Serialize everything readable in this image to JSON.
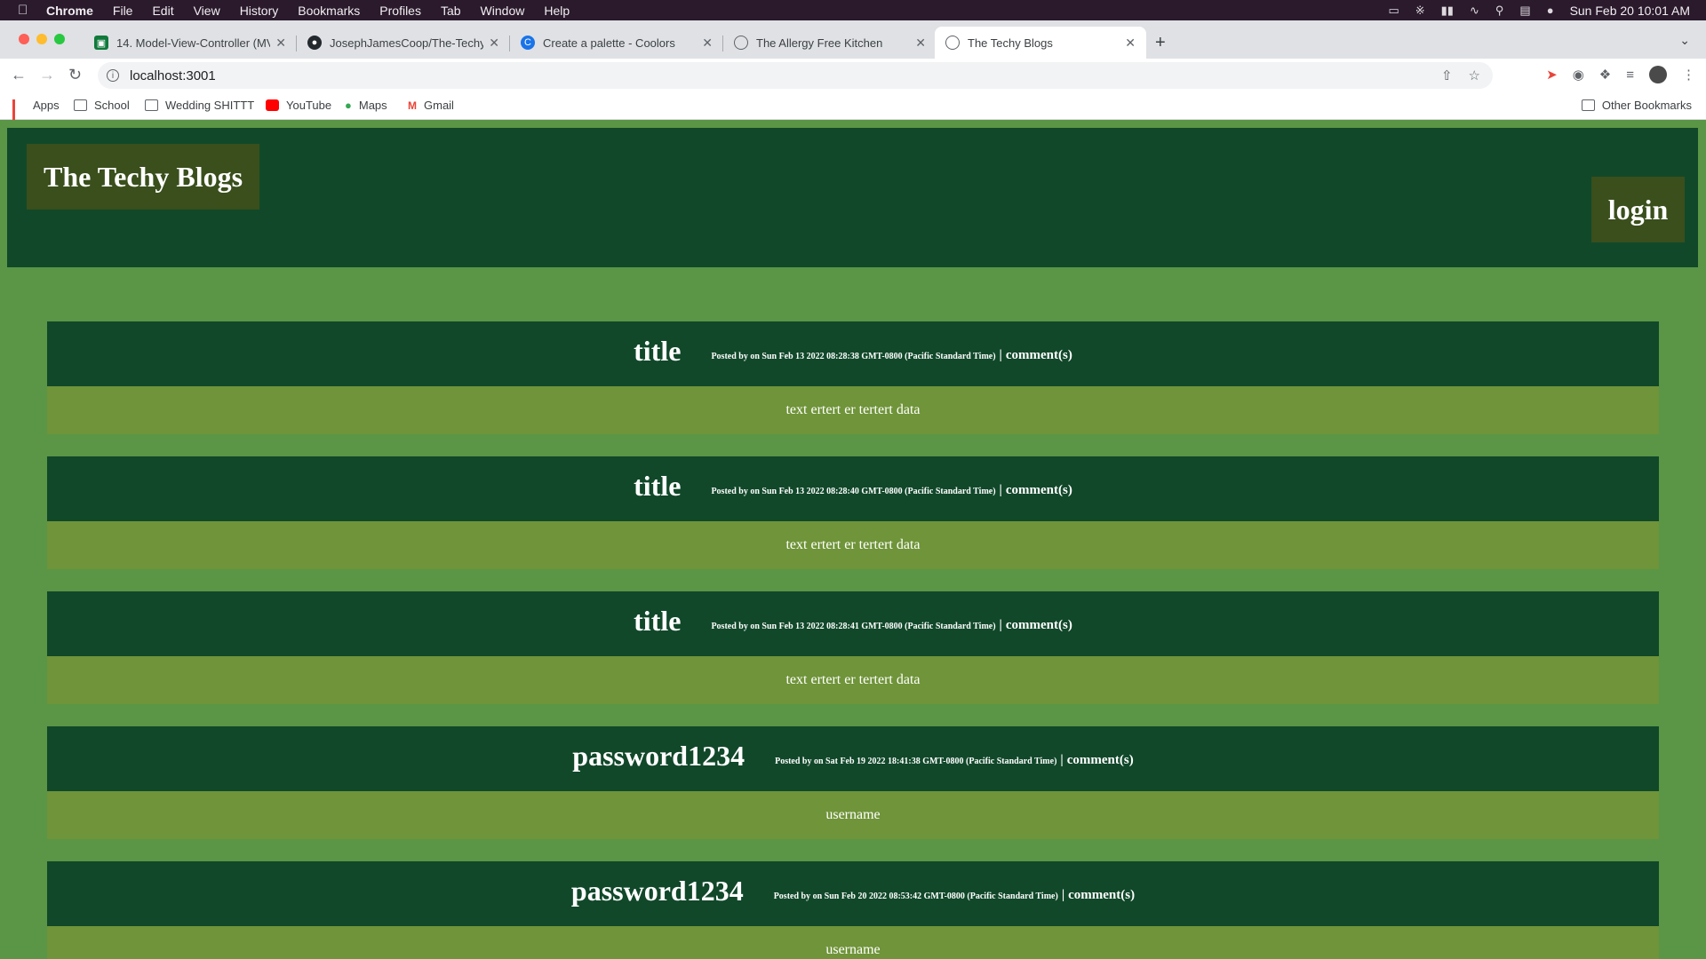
{
  "menubar": {
    "app": "Chrome",
    "items": [
      "File",
      "Edit",
      "View",
      "History",
      "Bookmarks",
      "Profiles",
      "Tab",
      "Window",
      "Help"
    ],
    "clock": "Sun Feb 20  10:01 AM"
  },
  "tabs": [
    {
      "label": "14. Model-View-Controller (MV",
      "favicon": "green-square-icon"
    },
    {
      "label": "JosephJamesCoop/The-Techy",
      "favicon": "github-icon"
    },
    {
      "label": "Create a palette - Coolors",
      "favicon": "coolors-icon"
    },
    {
      "label": "The Allergy Free Kitchen",
      "favicon": "globe-icon"
    },
    {
      "label": "The Techy Blogs",
      "favicon": "globe-icon",
      "active": true
    }
  ],
  "toolbar": {
    "url": "localhost:3001"
  },
  "bookmarks": {
    "items": [
      "Apps",
      "School",
      "Wedding SHITTT",
      "YouTube",
      "Maps",
      "Gmail"
    ],
    "other": "Other Bookmarks"
  },
  "site": {
    "title": "The Techy Blogs",
    "login": "login"
  },
  "posts": [
    {
      "title": "title",
      "meta": "Posted by on Sun Feb 13 2022 08:28:38 GMT-0800 (Pacific Standard Time)",
      "sep": "|",
      "comments": "comment(s)",
      "body": "text ertert er tertert data"
    },
    {
      "title": "title",
      "meta": "Posted by on Sun Feb 13 2022 08:28:40 GMT-0800 (Pacific Standard Time)",
      "sep": "|",
      "comments": "comment(s)",
      "body": "text ertert er tertert data"
    },
    {
      "title": "title",
      "meta": "Posted by on Sun Feb 13 2022 08:28:41 GMT-0800 (Pacific Standard Time)",
      "sep": "|",
      "comments": "comment(s)",
      "body": "text ertert er tertert data"
    },
    {
      "title": "password1234",
      "meta": "Posted by on Sat Feb 19 2022 18:41:38 GMT-0800 (Pacific Standard Time)",
      "sep": "|",
      "comments": "comment(s)",
      "body": "username"
    },
    {
      "title": "password1234",
      "meta": "Posted by on Sun Feb 20 2022 08:53:42 GMT-0800 (Pacific Standard Time)",
      "sep": "|",
      "comments": "comment(s)",
      "body": "username"
    }
  ],
  "colors": {
    "header": "#11482a",
    "accent_box": "#3a4f1c",
    "page_bg": "#5a9645",
    "post_body": "#6f9439"
  }
}
